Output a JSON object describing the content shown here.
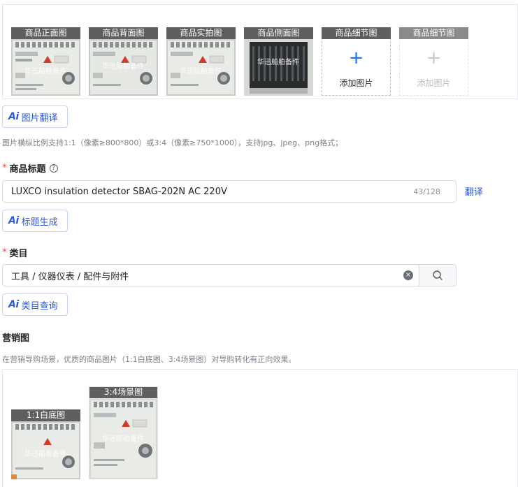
{
  "images": {
    "slots": [
      {
        "label": "商品正面图",
        "watermark": "华迅船舶备件"
      },
      {
        "label": "商品背面图",
        "watermark": "华迅船舶备件"
      },
      {
        "label": "商品实拍图",
        "watermark": "华迅船舶备件"
      },
      {
        "label": "商品侧面图",
        "watermark": "华迅船舶备件"
      }
    ],
    "add_slots": [
      {
        "label": "商品细节图",
        "text": "添加图片",
        "plus": "+"
      },
      {
        "label": "商品细节图",
        "text": "添加图片",
        "plus": "+"
      }
    ],
    "translate_button": "图片翻译",
    "hint": "图片横纵比例支持1:1（像素≥800*800）或3:4（像素≥750*1000），支持jpg、jpeg、png格式；"
  },
  "ai_mark": "Ai",
  "title_field": {
    "required_mark": "*",
    "label": "商品标题",
    "help": "?",
    "value": "LUXCO insulation detector SBAG-202N AC 220V",
    "counter": "43/128",
    "translate_link": "翻译",
    "generate_button": "标题生成"
  },
  "category_field": {
    "required_mark": "*",
    "label": "类目",
    "value": "工具 / 仪器仪表 / 配件与附件",
    "clear": "×",
    "query_button": "类目查询"
  },
  "marketing": {
    "title": "营销图",
    "hint": "在营销导购场景，优质的商品图片（1:1白底图、3:4场景图）对导购转化有正向效果。",
    "slots": [
      {
        "label": "1:1白底图",
        "watermark": "华迅船舶备件"
      },
      {
        "label": "3:4场景图",
        "watermark": "华迅船舶备件"
      }
    ]
  },
  "colors": {
    "accent": "#2e5bd6",
    "primary_blue": "#1677ff",
    "required": "#e5484d",
    "label_bg": "#5f5f5f"
  }
}
